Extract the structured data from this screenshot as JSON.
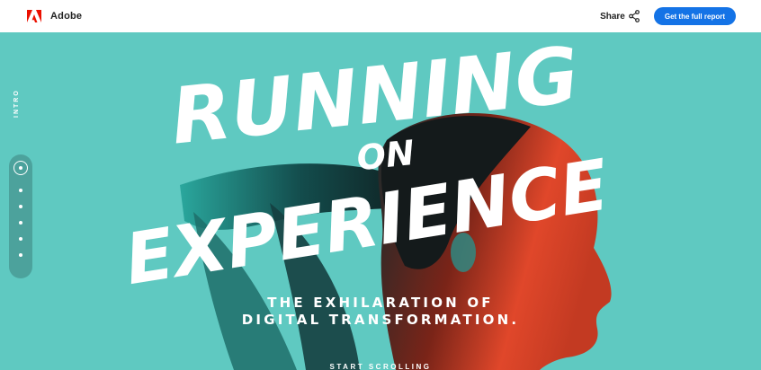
{
  "header": {
    "brand": "Adobe",
    "logo_icon": "adobe-logo-icon",
    "share_label": "Share",
    "share_icon": "share-icon",
    "cta_label": "Get the full report"
  },
  "colors": {
    "hero_background": "#5fc9c1",
    "cta": "#1473e6",
    "brand_red": "#eb1000",
    "runner_warm": "#e0472a"
  },
  "side_nav": {
    "label": "INTRO",
    "sections": 7,
    "active_index": 0
  },
  "hero": {
    "title_line1": "RUNNING",
    "title_line2": "ON",
    "title_line3": "EXPERIENCE",
    "subtitle_line1": "THE EXHILARATION OF",
    "subtitle_line2": "DIGITAL TRANSFORMATION.",
    "scroll_cue": "START SCROLLING"
  }
}
